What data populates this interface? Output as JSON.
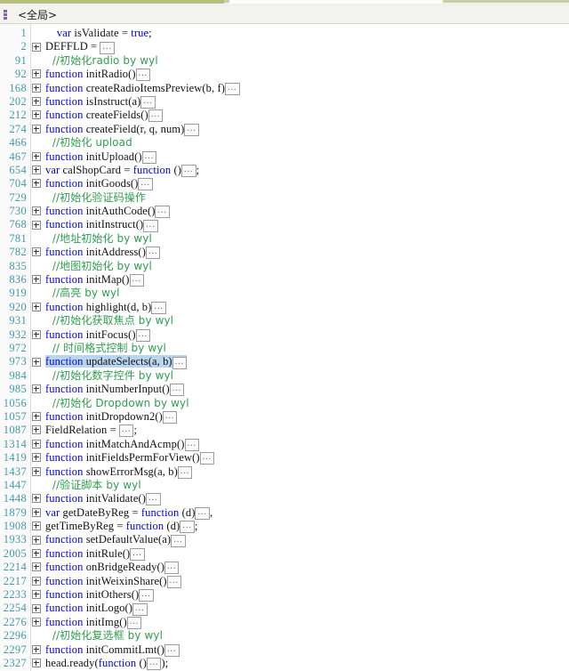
{
  "window": {
    "scope_label": "<全局>",
    "scope_icon": "list-bars-icon"
  },
  "colors": {
    "line_number": "#3f9aa8",
    "keyword": "#0000e0",
    "comment": "#2f9e4f",
    "selection": "#b9d5f0",
    "gutter_bg": "#fafafa",
    "editor_bg": "#ffffff",
    "titlebar_accent": "#b6bf7e"
  },
  "editor": {
    "lines": [
      {
        "num": "1",
        "fold": false,
        "selected": false,
        "segments": [
          {
            "t": "    ",
            "c": "plain"
          },
          {
            "t": "var",
            "c": "kw"
          },
          {
            "t": " isValidate = ",
            "c": "plain"
          },
          {
            "t": "true",
            "c": "kw"
          },
          {
            "t": ";",
            "c": "plain"
          }
        ]
      },
      {
        "num": "2",
        "fold": true,
        "selected": false,
        "segments": [
          {
            "t": "DEFFLD = ",
            "c": "plain"
          },
          {
            "t": "…",
            "c": "ellipsis"
          }
        ]
      },
      {
        "num": "91",
        "fold": false,
        "selected": false,
        "segments": [
          {
            "t": "  //初始化radio by wyl",
            "c": "cmt"
          }
        ]
      },
      {
        "num": "92",
        "fold": true,
        "selected": false,
        "segments": [
          {
            "t": "function",
            "c": "kw"
          },
          {
            "t": " initRadio()",
            "c": "plain"
          },
          {
            "t": "…",
            "c": "ellipsis"
          }
        ]
      },
      {
        "num": "168",
        "fold": true,
        "selected": false,
        "segments": [
          {
            "t": "function",
            "c": "kw"
          },
          {
            "t": " createRadioItemsPreview(b, f)",
            "c": "plain"
          },
          {
            "t": "…",
            "c": "ellipsis"
          }
        ]
      },
      {
        "num": "202",
        "fold": true,
        "selected": false,
        "segments": [
          {
            "t": "function",
            "c": "kw"
          },
          {
            "t": " isInstruct(a)",
            "c": "plain"
          },
          {
            "t": "…",
            "c": "ellipsis"
          }
        ]
      },
      {
        "num": "212",
        "fold": true,
        "selected": false,
        "segments": [
          {
            "t": "function",
            "c": "kw"
          },
          {
            "t": " createFields()",
            "c": "plain"
          },
          {
            "t": "…",
            "c": "ellipsis"
          }
        ]
      },
      {
        "num": "274",
        "fold": true,
        "selected": false,
        "segments": [
          {
            "t": "function",
            "c": "kw"
          },
          {
            "t": " createField(r, q, num)",
            "c": "plain"
          },
          {
            "t": "…",
            "c": "ellipsis"
          }
        ]
      },
      {
        "num": "466",
        "fold": false,
        "selected": false,
        "segments": [
          {
            "t": "  //初始化 upload",
            "c": "cmt"
          }
        ]
      },
      {
        "num": "467",
        "fold": true,
        "selected": false,
        "segments": [
          {
            "t": "function",
            "c": "kw"
          },
          {
            "t": " initUpload()",
            "c": "plain"
          },
          {
            "t": "…",
            "c": "ellipsis"
          }
        ]
      },
      {
        "num": "654",
        "fold": true,
        "selected": false,
        "segments": [
          {
            "t": "var",
            "c": "kw"
          },
          {
            "t": " calShopCard = ",
            "c": "plain"
          },
          {
            "t": "function",
            "c": "kw"
          },
          {
            "t": " ()",
            "c": "plain"
          },
          {
            "t": "…",
            "c": "ellipsis"
          },
          {
            "t": ";",
            "c": "plain"
          }
        ]
      },
      {
        "num": "704",
        "fold": true,
        "selected": false,
        "segments": [
          {
            "t": "function",
            "c": "kw"
          },
          {
            "t": " initGoods()",
            "c": "plain"
          },
          {
            "t": "…",
            "c": "ellipsis"
          }
        ]
      },
      {
        "num": "729",
        "fold": false,
        "selected": false,
        "segments": [
          {
            "t": "  //初始化验证码操作",
            "c": "cmt"
          }
        ]
      },
      {
        "num": "730",
        "fold": true,
        "selected": false,
        "segments": [
          {
            "t": "function",
            "c": "kw"
          },
          {
            "t": " initAuthCode()",
            "c": "plain"
          },
          {
            "t": "…",
            "c": "ellipsis"
          }
        ]
      },
      {
        "num": "768",
        "fold": true,
        "selected": false,
        "segments": [
          {
            "t": "function",
            "c": "kw"
          },
          {
            "t": " initInstruct()",
            "c": "plain"
          },
          {
            "t": "…",
            "c": "ellipsis"
          }
        ]
      },
      {
        "num": "781",
        "fold": false,
        "selected": false,
        "segments": [
          {
            "t": "  //地址初始化 by wyl",
            "c": "cmt"
          }
        ]
      },
      {
        "num": "782",
        "fold": true,
        "selected": false,
        "segments": [
          {
            "t": "function",
            "c": "kw"
          },
          {
            "t": " initAddress()",
            "c": "plain"
          },
          {
            "t": "…",
            "c": "ellipsis"
          }
        ]
      },
      {
        "num": "835",
        "fold": false,
        "selected": false,
        "segments": [
          {
            "t": "  //地图初始化 by wyl",
            "c": "cmt"
          }
        ]
      },
      {
        "num": "836",
        "fold": true,
        "selected": false,
        "segments": [
          {
            "t": "function",
            "c": "kw"
          },
          {
            "t": " initMap()",
            "c": "plain"
          },
          {
            "t": "…",
            "c": "ellipsis"
          }
        ]
      },
      {
        "num": "919",
        "fold": false,
        "selected": false,
        "segments": [
          {
            "t": "  //高亮 by wyl",
            "c": "cmt"
          }
        ]
      },
      {
        "num": "920",
        "fold": true,
        "selected": false,
        "segments": [
          {
            "t": "function",
            "c": "kw"
          },
          {
            "t": " highlight(d, b)",
            "c": "plain"
          },
          {
            "t": "…",
            "c": "ellipsis"
          }
        ]
      },
      {
        "num": "931",
        "fold": false,
        "selected": false,
        "segments": [
          {
            "t": "  //初始化获取焦点 by wyl",
            "c": "cmt"
          }
        ]
      },
      {
        "num": "932",
        "fold": true,
        "selected": false,
        "segments": [
          {
            "t": "function",
            "c": "kw"
          },
          {
            "t": " initFocus()",
            "c": "plain"
          },
          {
            "t": "…",
            "c": "ellipsis"
          }
        ]
      },
      {
        "num": "972",
        "fold": false,
        "selected": false,
        "segments": [
          {
            "t": "  // 时间格式控制 by wyl",
            "c": "cmt"
          }
        ]
      },
      {
        "num": "973",
        "fold": true,
        "selected": true,
        "segments": [
          {
            "t": "function",
            "c": "kw"
          },
          {
            "t": " updateSelects(a, b)",
            "c": "plain"
          },
          {
            "t": "…",
            "c": "ellipsis"
          }
        ]
      },
      {
        "num": "984",
        "fold": false,
        "selected": false,
        "segments": [
          {
            "t": "  //初始化数字控件 by wyl",
            "c": "cmt"
          }
        ]
      },
      {
        "num": "985",
        "fold": true,
        "selected": false,
        "segments": [
          {
            "t": "function",
            "c": "kw"
          },
          {
            "t": " initNumberInput()",
            "c": "plain"
          },
          {
            "t": "…",
            "c": "ellipsis"
          }
        ]
      },
      {
        "num": "1056",
        "fold": false,
        "selected": false,
        "segments": [
          {
            "t": "  //初始化 Dropdown by wyl",
            "c": "cmt"
          }
        ]
      },
      {
        "num": "1057",
        "fold": true,
        "selected": false,
        "segments": [
          {
            "t": "function",
            "c": "kw"
          },
          {
            "t": " initDropdown2()",
            "c": "plain"
          },
          {
            "t": "…",
            "c": "ellipsis"
          }
        ]
      },
      {
        "num": "1087",
        "fold": true,
        "selected": false,
        "segments": [
          {
            "t": "FieldRelation = ",
            "c": "plain"
          },
          {
            "t": "…",
            "c": "ellipsis"
          },
          {
            "t": ";",
            "c": "plain"
          }
        ]
      },
      {
        "num": "1314",
        "fold": true,
        "selected": false,
        "segments": [
          {
            "t": "function",
            "c": "kw"
          },
          {
            "t": " initMatchAndAcmp()",
            "c": "plain"
          },
          {
            "t": "…",
            "c": "ellipsis"
          }
        ]
      },
      {
        "num": "1419",
        "fold": true,
        "selected": false,
        "segments": [
          {
            "t": "function",
            "c": "kw"
          },
          {
            "t": " initFieldsPermForView()",
            "c": "plain"
          },
          {
            "t": "…",
            "c": "ellipsis"
          }
        ]
      },
      {
        "num": "1437",
        "fold": true,
        "selected": false,
        "segments": [
          {
            "t": "function",
            "c": "kw"
          },
          {
            "t": " showErrorMsg(a, b)",
            "c": "plain"
          },
          {
            "t": "…",
            "c": "ellipsis"
          }
        ]
      },
      {
        "num": "1447",
        "fold": false,
        "selected": false,
        "segments": [
          {
            "t": "  //验证脚本 by wyl",
            "c": "cmt"
          }
        ]
      },
      {
        "num": "1448",
        "fold": true,
        "selected": false,
        "segments": [
          {
            "t": "function",
            "c": "kw"
          },
          {
            "t": " initValidate()",
            "c": "plain"
          },
          {
            "t": "…",
            "c": "ellipsis"
          }
        ]
      },
      {
        "num": "1879",
        "fold": true,
        "selected": false,
        "segments": [
          {
            "t": "var",
            "c": "kw"
          },
          {
            "t": " getDateByReg = ",
            "c": "plain"
          },
          {
            "t": "function",
            "c": "kw"
          },
          {
            "t": " (d)",
            "c": "plain"
          },
          {
            "t": "…",
            "c": "ellipsis"
          },
          {
            "t": ",",
            "c": "plain"
          }
        ]
      },
      {
        "num": "1908",
        "fold": true,
        "selected": false,
        "segments": [
          {
            "t": "getTimeByReg = ",
            "c": "plain"
          },
          {
            "t": "function",
            "c": "kw"
          },
          {
            "t": " (d)",
            "c": "plain"
          },
          {
            "t": "…",
            "c": "ellipsis"
          },
          {
            "t": ";",
            "c": "plain"
          }
        ]
      },
      {
        "num": "1933",
        "fold": true,
        "selected": false,
        "segments": [
          {
            "t": "function",
            "c": "kw"
          },
          {
            "t": " setDefaultValue(a)",
            "c": "plain"
          },
          {
            "t": "…",
            "c": "ellipsis"
          }
        ]
      },
      {
        "num": "2005",
        "fold": true,
        "selected": false,
        "segments": [
          {
            "t": "function",
            "c": "kw"
          },
          {
            "t": " initRule()",
            "c": "plain"
          },
          {
            "t": "…",
            "c": "ellipsis"
          }
        ]
      },
      {
        "num": "2214",
        "fold": true,
        "selected": false,
        "segments": [
          {
            "t": "function",
            "c": "kw"
          },
          {
            "t": " onBridgeReady()",
            "c": "plain"
          },
          {
            "t": "…",
            "c": "ellipsis"
          }
        ]
      },
      {
        "num": "2217",
        "fold": true,
        "selected": false,
        "segments": [
          {
            "t": "function",
            "c": "kw"
          },
          {
            "t": " initWeixinShare()",
            "c": "plain"
          },
          {
            "t": "…",
            "c": "ellipsis"
          }
        ]
      },
      {
        "num": "2233",
        "fold": true,
        "selected": false,
        "segments": [
          {
            "t": "function",
            "c": "kw"
          },
          {
            "t": " initOthers()",
            "c": "plain"
          },
          {
            "t": "…",
            "c": "ellipsis"
          }
        ]
      },
      {
        "num": "2254",
        "fold": true,
        "selected": false,
        "segments": [
          {
            "t": "function",
            "c": "kw"
          },
          {
            "t": " initLogo()",
            "c": "plain"
          },
          {
            "t": "…",
            "c": "ellipsis"
          }
        ]
      },
      {
        "num": "2276",
        "fold": true,
        "selected": false,
        "segments": [
          {
            "t": "function",
            "c": "kw"
          },
          {
            "t": " initImg()",
            "c": "plain"
          },
          {
            "t": "…",
            "c": "ellipsis"
          }
        ]
      },
      {
        "num": "2296",
        "fold": false,
        "selected": false,
        "segments": [
          {
            "t": "  //初始化复选框 by wyl",
            "c": "cmt"
          }
        ]
      },
      {
        "num": "2297",
        "fold": true,
        "selected": false,
        "segments": [
          {
            "t": "function",
            "c": "kw"
          },
          {
            "t": " initCommitLmt()",
            "c": "plain"
          },
          {
            "t": "…",
            "c": "ellipsis"
          }
        ]
      },
      {
        "num": "2327",
        "fold": true,
        "selected": false,
        "segments": [
          {
            "t": "head.ready(",
            "c": "plain"
          },
          {
            "t": "function",
            "c": "kw"
          },
          {
            "t": " ()",
            "c": "plain"
          },
          {
            "t": "…",
            "c": "ellipsis"
          },
          {
            "t": ");",
            "c": "plain"
          }
        ]
      }
    ]
  }
}
